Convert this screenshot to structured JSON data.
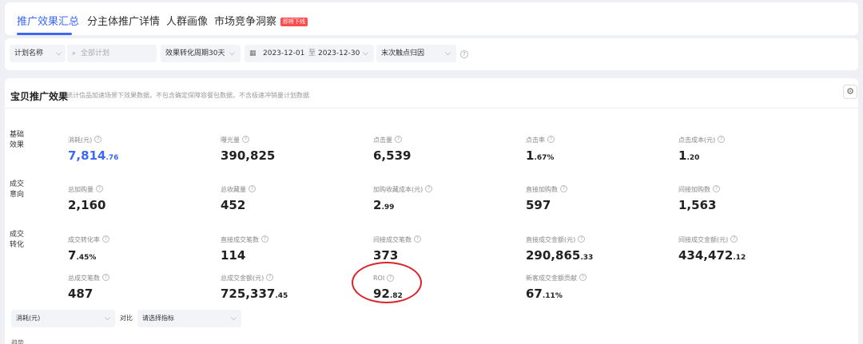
{
  "tabs": [
    {
      "label": "推广效果汇总"
    },
    {
      "label": "分主体推广详情"
    },
    {
      "label": "人群画像"
    },
    {
      "label": "市场竞争洞察"
    }
  ],
  "tab_badge": "即将下线",
  "filters": {
    "plan_name_label": "计划名称",
    "search_placeholder": "全部计划",
    "conversion_period": "效果转化周期30天",
    "date_start": "2023-12-01",
    "date_sep": "至",
    "date_end": "2023-12-30",
    "attribution": "末次触点归因"
  },
  "panel": {
    "title": "宝贝推广效果",
    "description": "统计信品加速场景下效果数据，不包含确定保障容餐包数据，不含极速冲销量计划数据"
  },
  "rows": [
    {
      "label": "基础效果"
    },
    {
      "label": "成交意向"
    },
    {
      "label": "成交转化"
    }
  ],
  "metrics": {
    "spend": {
      "label": "消耗(元)",
      "int": "7,814",
      "dec": ".76"
    },
    "impressions": {
      "label": "曝光量",
      "int": "390,825",
      "dec": ""
    },
    "clicks": {
      "label": "点击量",
      "int": "6,539",
      "dec": ""
    },
    "ctr": {
      "label": "点击率",
      "int": "1",
      "dec": ".67%"
    },
    "cpc": {
      "label": "点击成本(元)",
      "int": "1",
      "dec": ".20"
    },
    "cart_total": {
      "label": "总加购量",
      "int": "2,160",
      "dec": ""
    },
    "favorites_total": {
      "label": "总收藏量",
      "int": "452",
      "dec": ""
    },
    "cart_fav_cost": {
      "label": "加购收藏成本(元)",
      "int": "2",
      "dec": ".99"
    },
    "cart_direct": {
      "label": "直接加购数",
      "int": "597",
      "dec": ""
    },
    "cart_indirect": {
      "label": "间接加购数",
      "int": "1,563",
      "dec": ""
    },
    "cvr": {
      "label": "成交转化率",
      "int": "7",
      "dec": ".45%"
    },
    "orders_direct": {
      "label": "直接成交笔数",
      "int": "114",
      "dec": ""
    },
    "orders_indirect": {
      "label": "间接成交笔数",
      "int": "373",
      "dec": ""
    },
    "gmv_direct": {
      "label": "直接成交金额(元)",
      "int": "290,865",
      "dec": ".33"
    },
    "gmv_indirect": {
      "label": "间接成交金额(元)",
      "int": "434,472",
      "dec": ".12"
    },
    "orders_total": {
      "label": "总成交笔数",
      "int": "487",
      "dec": ""
    },
    "gmv_total": {
      "label": "总成交金额(元)",
      "int": "725,337",
      "dec": ".45"
    },
    "roi": {
      "label": "ROI",
      "int": "92",
      "dec": ".82"
    },
    "new_customer_share": {
      "label": "新客成交金额贡献",
      "int": "67",
      "dec": ".11%"
    }
  },
  "compare": {
    "metric_select": "消耗(元)",
    "vs_label": "对比",
    "compare_placeholder": "请选择指标"
  },
  "footer_label": "趋势"
}
